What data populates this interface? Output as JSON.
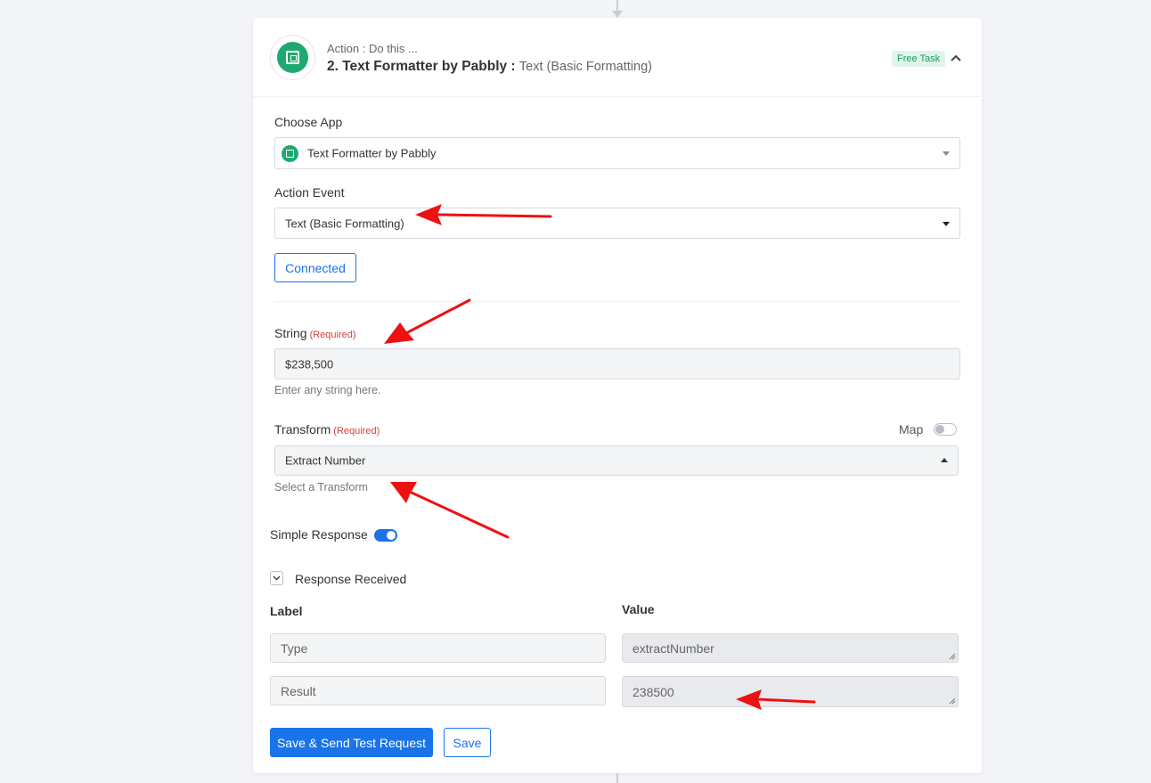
{
  "header": {
    "action_sub": "Action : Do this ...",
    "action_title": "2. Text Formatter by Pabbly : ",
    "action_event_name": "Text (Basic Formatting)",
    "badge": "Free Task",
    "icon": "text-formatter-app-icon"
  },
  "choose_app": {
    "label": "Choose App",
    "value": "Text Formatter by Pabbly"
  },
  "action_event": {
    "label": "Action Event",
    "value": "Text (Basic Formatting)"
  },
  "connection": {
    "button_label": "Connected"
  },
  "string_field": {
    "label": "String",
    "required": "(Required)",
    "value": "$238,500",
    "help": "Enter any string here."
  },
  "transform_field": {
    "label": "Transform",
    "required": "(Required)",
    "map_label": "Map",
    "value": "Extract Number",
    "help": "Select a Transform"
  },
  "simple_response": {
    "label": "Simple Response",
    "enabled": true
  },
  "response": {
    "label": "Response Received",
    "columns": {
      "label": "Label",
      "value": "Value"
    },
    "rows": [
      {
        "label": "Type",
        "value": "extractNumber"
      },
      {
        "label": "Result",
        "value": "238500"
      }
    ]
  },
  "actions": {
    "primary": "Save & Send Test Request",
    "secondary": "Save"
  },
  "colors": {
    "accent": "#1a73e8",
    "app_green": "#1fa970",
    "required": "#d0443c",
    "annotation_arrow": "#ee1111"
  }
}
